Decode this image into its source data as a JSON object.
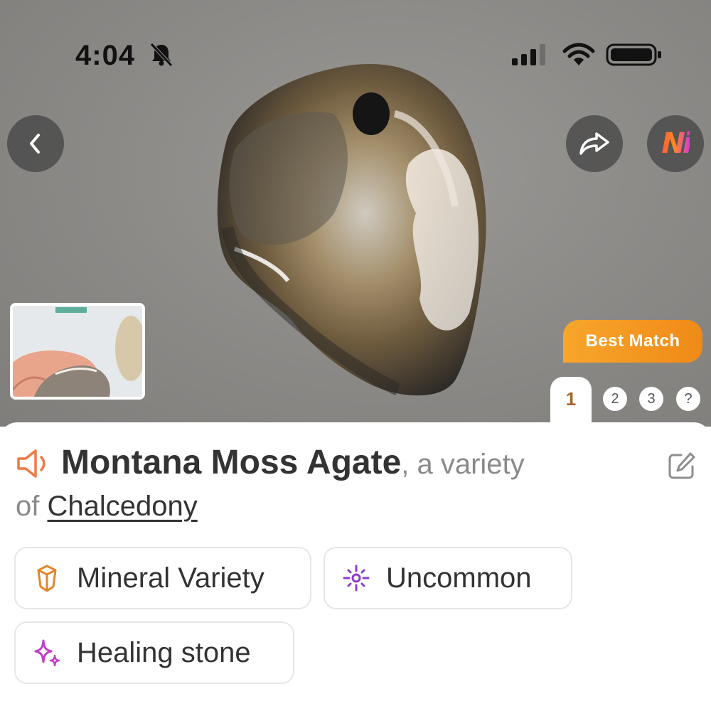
{
  "status_bar": {
    "time": "4:04",
    "icons": [
      "bell-muted-icon",
      "cellular-signal-icon",
      "wifi-icon",
      "battery-icon"
    ]
  },
  "nav": {
    "back_icon": "chevron-left-icon",
    "share_icon": "share-arrow-icon",
    "ai_label": "Ni"
  },
  "result": {
    "badge": "Best Match",
    "tabs": [
      "1",
      "2",
      "3",
      "?"
    ],
    "active_tab": "1"
  },
  "info": {
    "name": "Montana Moss Agate",
    "variety_text": ", a variety",
    "of_text": "of",
    "parent": "Chalcedony",
    "tags": [
      {
        "label": "Mineral Variety",
        "icon": "crystal-icon",
        "color": "#e0872b"
      },
      {
        "label": "Uncommon",
        "icon": "sparkle-burst-icon",
        "color": "#8a3fd1"
      },
      {
        "label": "Healing stone",
        "icon": "sparkles-icon",
        "color": "#c23fc9"
      }
    ]
  },
  "colors": {
    "accent_orange": "#f29220",
    "tab_active_text": "#a5652a",
    "speaker_icon": "#ee7a45"
  }
}
